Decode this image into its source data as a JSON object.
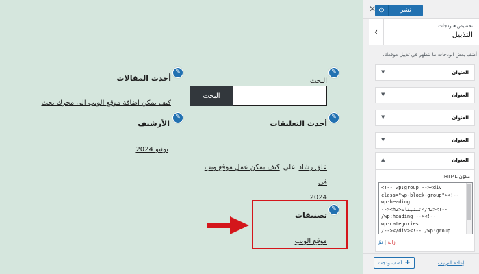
{
  "preview": {
    "recent_posts": {
      "title": "أحدث المقالات",
      "link": "كيف يمكن اضافة موقع الويب الى محرك بحث"
    },
    "search": {
      "label": "البحث",
      "button": "البحث",
      "placeholder": ""
    },
    "archive": {
      "title": "الأرشيف",
      "link": "يونيو 2024"
    },
    "recent_comments": {
      "title": "أحدث التعليقات",
      "author": "علق رشاد",
      "on": "على",
      "post_line1": "كيف يمكن عمل موقع ويب في",
      "post_line2": "2024"
    },
    "categories": {
      "title": "تصنيفات",
      "link": "موقع الويب"
    }
  },
  "sidebar": {
    "publish_label": "نشر",
    "breadcrumb": "تخصيص ◂ ودجات",
    "panel_title": "التذييل",
    "description": "أضف بعض الودجات ما لتظهر في تذييل موقعك.",
    "widget_label": "العنوان",
    "items": [
      {
        "label": "العنوان"
      },
      {
        "label": "العنوان"
      },
      {
        "label": "العنوان"
      },
      {
        "label": "العنوان"
      },
      {
        "label": "العنوان"
      }
    ],
    "html_label": "مكوّن HTML:",
    "code_lines": [
      "<!-- wp:group --><div",
      "class=\"wp-block-group\"><!--",
      "wp:heading",
      "--><h2>تصنيفات</h2><!--",
      "/wp:heading --><!--",
      "wp:categories",
      "/--></div><!-- /wp:group"
    ],
    "remove_link": "إزالة",
    "done_link": "تمّ",
    "add_widget_label": "أضف ودجت",
    "reorder_label": "إعادة الترتيب"
  },
  "colors": {
    "preview_bg": "#d5e6dd",
    "accent": "#2271b1",
    "highlight": "#d4161b"
  }
}
